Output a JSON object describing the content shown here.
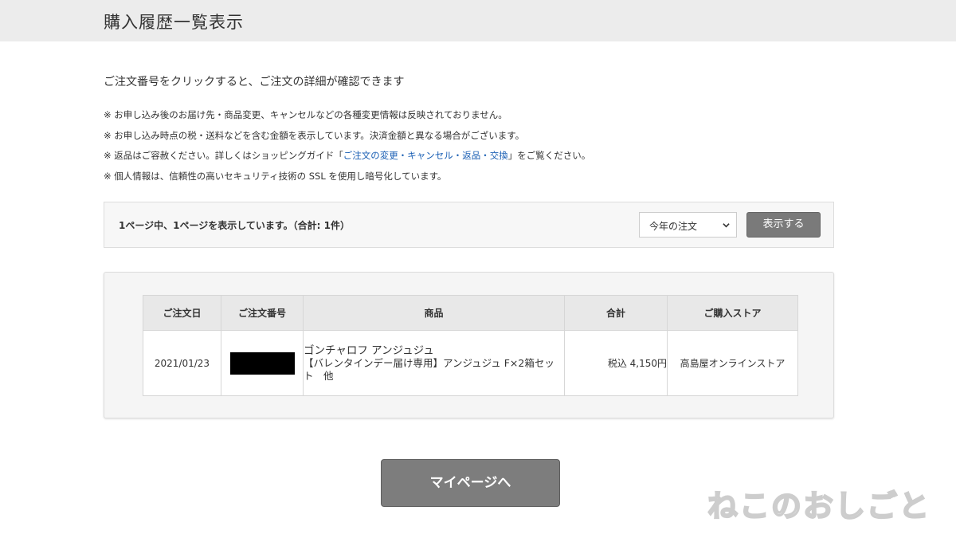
{
  "header": {
    "title": "購入履歴一覧表示"
  },
  "intro": "ご注文番号をクリックすると、ご注文の詳細が確認できます",
  "notes": [
    {
      "text": "※ お申し込み後のお届け先・商品変更、キャンセルなどの各種変更情報は反映されておりません。"
    },
    {
      "text": "※ お申し込み時点の税・送料などを含む金額を表示しています。決済金額と異なる場合がございます。"
    },
    {
      "before": "※ 返品はご容赦ください。詳しくはショッピングガイド「",
      "link": "ご注文の変更・キャンセル・返品・交換",
      "after": "」をご覧ください。"
    },
    {
      "text": "※ 個人情報は、信頼性の高いセキュリティ技術の SSL を使用し暗号化しています。"
    }
  ],
  "pager": {
    "text": "1ページ中、1ページを表示しています。（合計: 1件）",
    "period_selected": "今年の注文",
    "show_button": "表示する"
  },
  "orders": {
    "headers": {
      "date": "ご注文日",
      "number": "ご注文番号",
      "product": "商品",
      "total": "合計",
      "store": "ご購入ストア"
    },
    "rows": [
      {
        "date": "2021/01/23",
        "number": "",
        "product_line1": "ゴンチャロフ アンジュジュ",
        "product_line2": "【バレンタインデー届け専用】アンジュジュ F×2箱セット　他",
        "total": "税込 4,150円",
        "store": "高島屋オンラインストア"
      }
    ]
  },
  "mypage_button": "マイページへ",
  "watermark": "ねこのおしごと",
  "colors": {
    "header_bg": "#ececec",
    "link": "#1a5fb4",
    "button_bg": "#7a7a7a",
    "table_header_bg": "#e8e8e8"
  }
}
